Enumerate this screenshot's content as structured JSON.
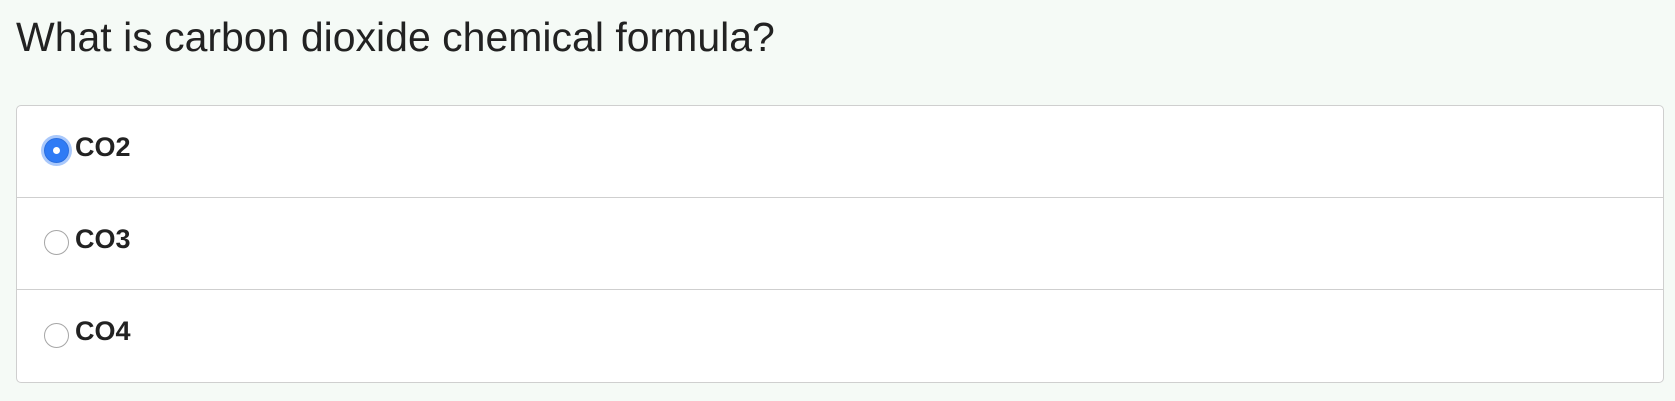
{
  "question": {
    "text": "What is carbon dioxide chemical formula?"
  },
  "options": [
    {
      "label": "CO2",
      "selected": true
    },
    {
      "label": "CO3",
      "selected": false
    },
    {
      "label": "CO4",
      "selected": false
    }
  ],
  "colors": {
    "page_background": "#f5faf6",
    "accent": "#2f7bf5",
    "border": "#cfcfcf",
    "text": "#222222"
  }
}
